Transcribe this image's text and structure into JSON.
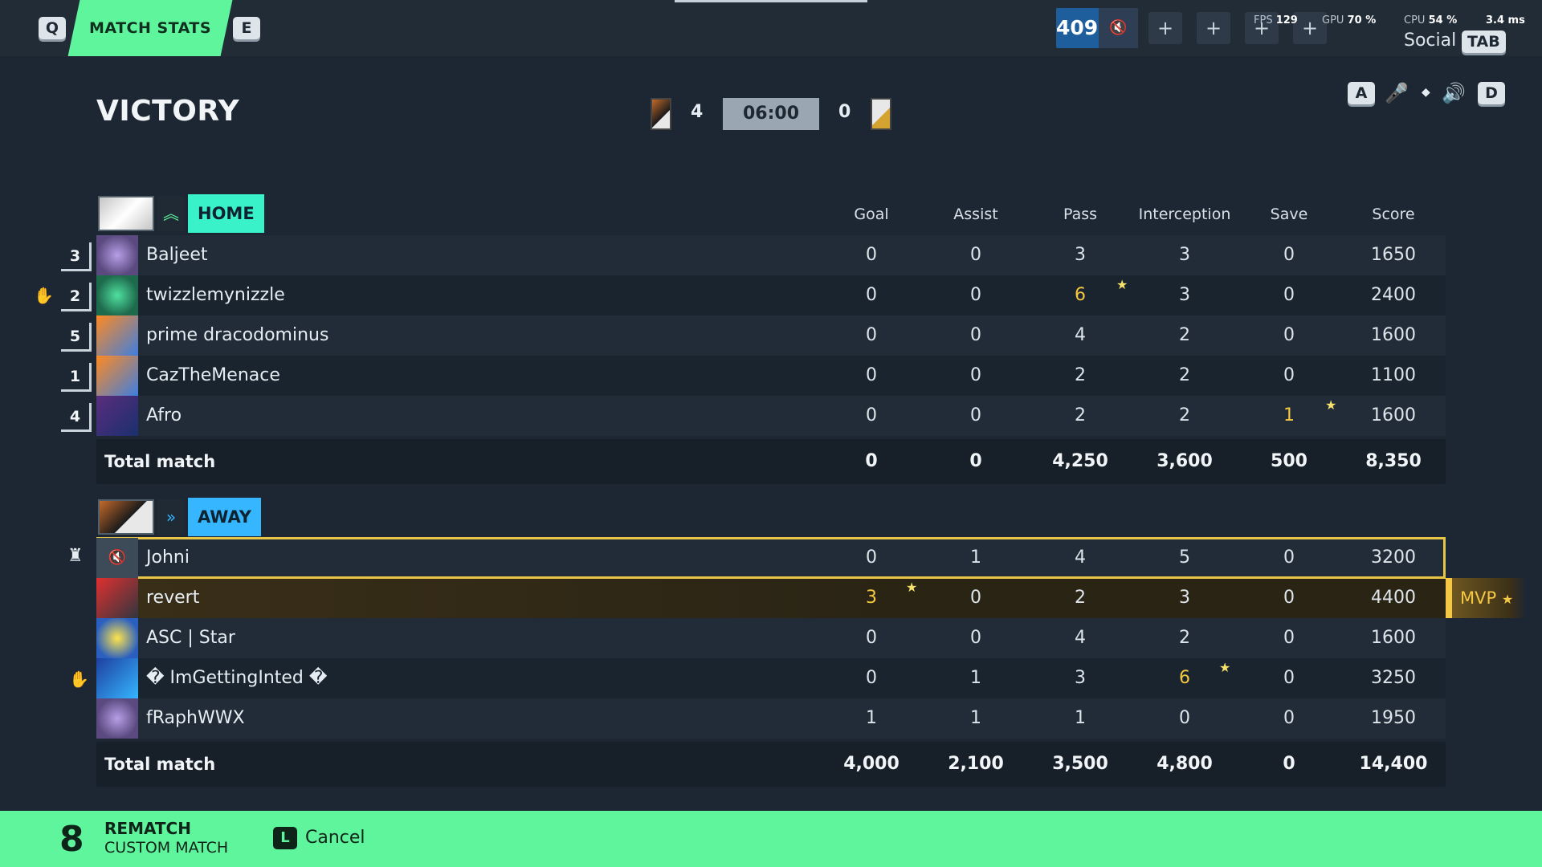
{
  "topbar": {
    "key_left": "Q",
    "tab_label": "MATCH STATS",
    "key_right": "E",
    "score_value": "409",
    "mute_icon": "speaker-muted-icon",
    "fps_label": "FPS",
    "fps_value": "129",
    "gpu_label": "GPU",
    "gpu_value": "70 %",
    "cpu_label": "CPU",
    "cpu_value": "54 %",
    "ms_value": "3.4 ms",
    "social_label": "Social",
    "social_key": "TAB"
  },
  "match": {
    "result": "VICTORY",
    "home_score": "4",
    "timer": "06:00",
    "away_score": "0",
    "controls": {
      "key_a": "A",
      "key_d": "D"
    }
  },
  "columns": [
    "Goal",
    "Assist",
    "Pass",
    "Interception",
    "Save",
    "Score"
  ],
  "home": {
    "label": "HOME",
    "color": "#39f2c9",
    "players": [
      {
        "rank": "3",
        "name": "Baljeet",
        "stats": [
          "0",
          "0",
          "3",
          "3",
          "0",
          "1650"
        ]
      },
      {
        "rank": "2",
        "name": "twizzlemynizzle",
        "stats": [
          "0",
          "0",
          "6",
          "3",
          "0",
          "2400"
        ]
      },
      {
        "rank": "5",
        "name": "prime dracodominus",
        "stats": [
          "0",
          "0",
          "4",
          "2",
          "0",
          "1600"
        ]
      },
      {
        "rank": "1",
        "name": "CazTheMenace",
        "stats": [
          "0",
          "0",
          "2",
          "2",
          "0",
          "1100"
        ]
      },
      {
        "rank": "4",
        "name": "Afro",
        "stats": [
          "0",
          "0",
          "2",
          "2",
          "1",
          "1600"
        ]
      }
    ],
    "total_label": "Total match",
    "totals": [
      "0",
      "0",
      "4,250",
      "3,600",
      "500",
      "8,350"
    ]
  },
  "away": {
    "label": "AWAY",
    "color": "#35b6ff",
    "players": [
      {
        "name": "Johni",
        "stats": [
          "0",
          "1",
          "4",
          "5",
          "0",
          "3200"
        ]
      },
      {
        "name": "revert",
        "stats": [
          "3",
          "0",
          "2",
          "3",
          "0",
          "4400"
        ]
      },
      {
        "name": "ASC | Star",
        "stats": [
          "0",
          "0",
          "4",
          "2",
          "0",
          "1600"
        ]
      },
      {
        "name": "� ImGettingInted �",
        "stats": [
          "0",
          "1",
          "3",
          "6",
          "0",
          "3250"
        ]
      },
      {
        "name": "fRaphWWX",
        "stats": [
          "1",
          "1",
          "1",
          "0",
          "0",
          "1950"
        ]
      }
    ],
    "total_label": "Total match",
    "totals": [
      "4,000",
      "2,100",
      "3,500",
      "4,800",
      "0",
      "14,400"
    ]
  },
  "mvp_label": "MVP",
  "bottom": {
    "count": "8",
    "title": "REMATCH",
    "subtitle": "CUSTOM MATCH",
    "cancel_key": "L",
    "cancel_label": "Cancel"
  }
}
